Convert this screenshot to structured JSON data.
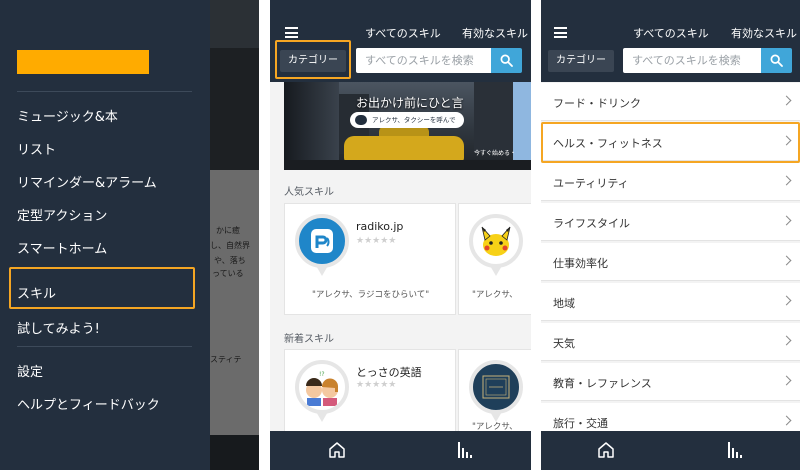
{
  "panel1": {
    "menu_items": [
      "ミュージック&本",
      "リスト",
      "リマインダー&アラーム",
      "定型アクション",
      "スマートホーム",
      "スキル",
      "試してみよう!",
      "設定",
      "ヘルプとフィードバック"
    ],
    "background_peek": [
      "かに癒",
      "し、自然界",
      "や、落ち",
      "っている",
      "スティテ"
    ]
  },
  "panel2": {
    "tabs": {
      "all_skills": "すべてのスキル",
      "enabled_skills": "有効なスキル"
    },
    "category_button": "カテゴリー",
    "search": {
      "placeholder": "すべてのスキルを検索"
    },
    "banner": {
      "title": "お出かけ前にひと言",
      "pill": "アレクサ、タクシーを呼んで",
      "cta": "今すぐ始める・"
    },
    "popular": {
      "title": "人気スキル",
      "cards": [
        {
          "name": "radiko.jp",
          "stars": "★★★★★",
          "quote": "\"アレクサ、ラジコをひらいて\""
        },
        {
          "name": "",
          "stars": "",
          "quote": "\"アレクサ、"
        }
      ]
    },
    "new": {
      "title": "新着スキル",
      "cards": [
        {
          "name": "とっさの英語",
          "stars": "★★★★★",
          "quote": ""
        },
        {
          "name": "",
          "stars": "",
          "quote": "\"アレクサ、"
        }
      ]
    }
  },
  "panel3": {
    "tabs": {
      "all_skills": "すべてのスキル",
      "enabled_skills": "有効なスキル"
    },
    "category_button": "カテゴリー",
    "search": {
      "placeholder": "すべてのスキルを検索"
    },
    "categories": [
      "フード・ドリンク",
      "ヘルス・フィットネス",
      "ユーティリティ",
      "ライフスタイル",
      "仕事効率化",
      "地域",
      "天気",
      "教育・レファレンス",
      "旅行・交通"
    ]
  },
  "colors": {
    "header": "#232f3e",
    "highlight": "#f5a623",
    "accent": "#ffab00",
    "search_button": "#40a6d9"
  },
  "icons": [
    "menu-icon",
    "search-icon",
    "home-icon",
    "activity-icon",
    "chevron-right-icon",
    "taxi-icon"
  ]
}
